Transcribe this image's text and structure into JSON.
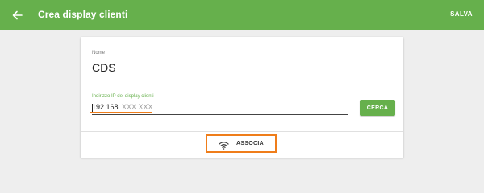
{
  "header": {
    "title": "Crea display clienti",
    "back_icon": "arrow-left-icon",
    "save_label": "SALVA",
    "background_color": "#66b04c"
  },
  "form": {
    "name": {
      "label": "Nome",
      "value": "CDS"
    },
    "ip": {
      "label": "Indirizzo IP del display clienti",
      "value": "192.168.",
      "placeholder": "XXX.XXX"
    },
    "search_label": "CERCA",
    "associate": {
      "icon": "wifi-icon",
      "label": "ASSOCIA"
    }
  },
  "colors": {
    "accent": "#66b04c",
    "highlight": "#ef7d1a"
  }
}
